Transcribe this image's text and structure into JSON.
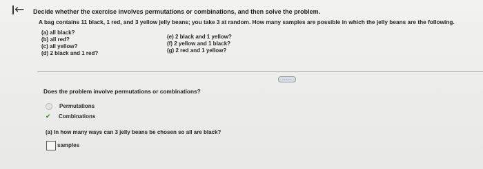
{
  "header": {
    "back_icon": "back-arrow-icon",
    "instruction": "Decide whether the exercise involves permutations or combinations, and then solve the problem."
  },
  "problem": {
    "statement": "A bag contains 11 black, 1 red, and 3 yellow jelly beans; you take 3 at random. How many samples are possible in which the jelly beans are the following.",
    "parts_left": [
      "(a) all black?",
      "(b) all red?",
      "(c) all yellow?",
      "(d) 2 black and 1 red?"
    ],
    "parts_right": [
      "(e) 2 black and 1 yellow?",
      "(f) 2 yellow and 1 black?",
      "(g) 2 red and 1 yellow?"
    ]
  },
  "more_button": {
    "label": "....."
  },
  "question": {
    "prompt": "Does the problem involve permutations or combinations?",
    "options": [
      {
        "label": "Permutations",
        "selected": false
      },
      {
        "label": "Combinations",
        "selected": true
      }
    ]
  },
  "part_a": {
    "prompt": "(a) In how many ways can 3 jelly beans be chosen so all are black?",
    "input_value": "",
    "unit": "samples"
  },
  "colors": {
    "check": "#3b7d1e",
    "divider": "#a8a8a8"
  }
}
